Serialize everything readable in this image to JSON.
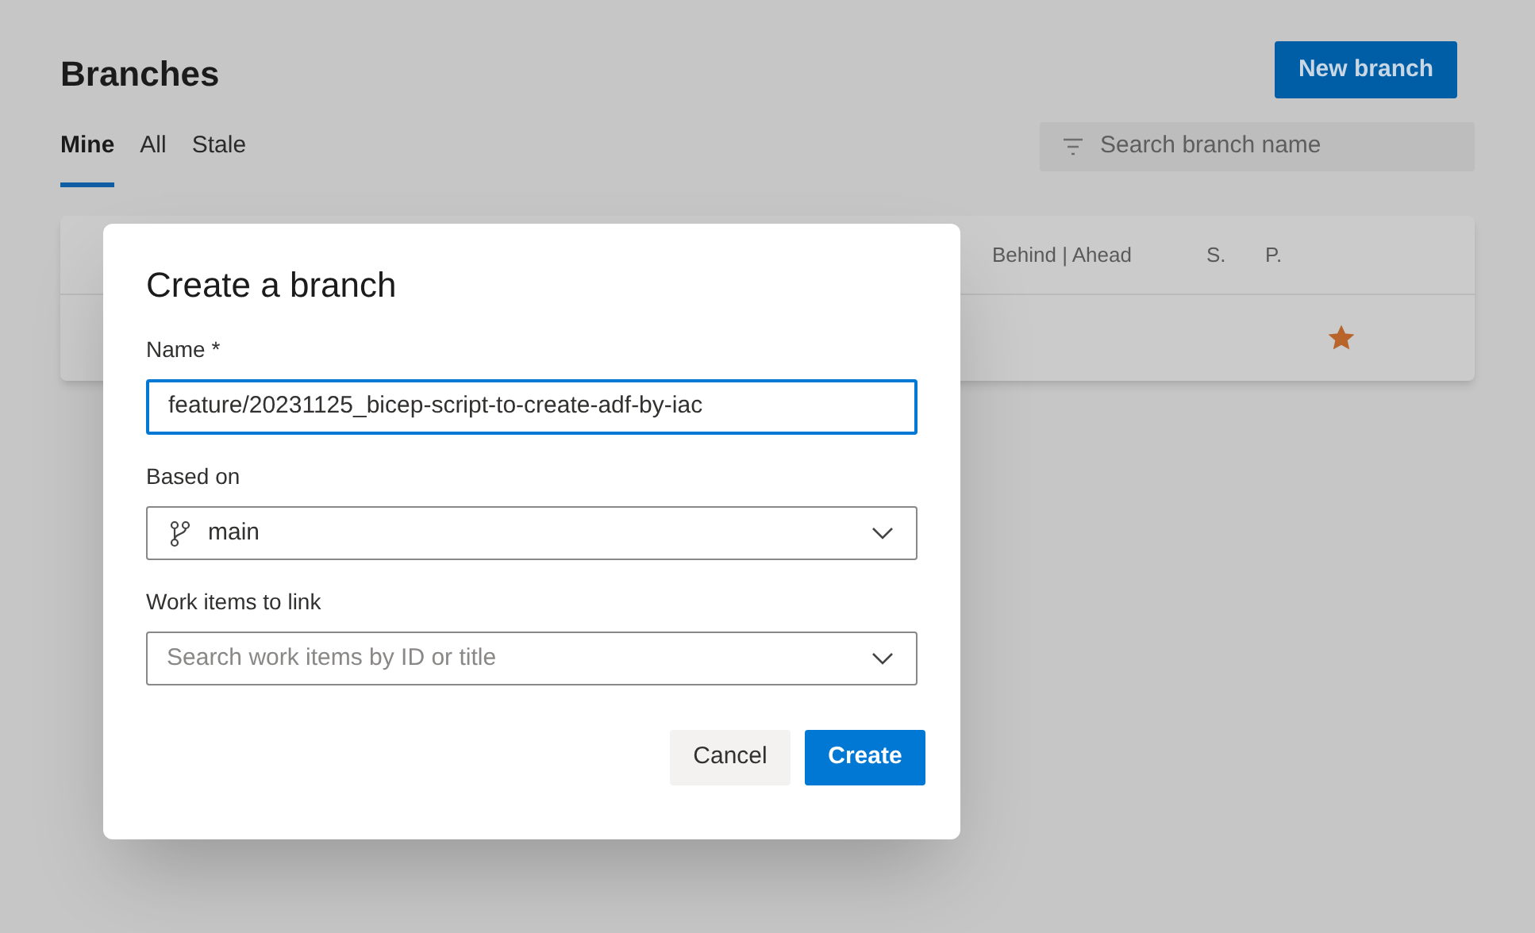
{
  "page": {
    "title": "Branches",
    "new_button": "New branch",
    "tabs": [
      {
        "label": "Mine",
        "selected": true
      },
      {
        "label": "All",
        "selected": false
      },
      {
        "label": "Stale",
        "selected": false
      }
    ],
    "search": {
      "placeholder": "Search branch name"
    },
    "table": {
      "columns": [
        "Behind | Ahead",
        "S.",
        "P."
      ],
      "rows": [
        {
          "favorite": true
        }
      ]
    }
  },
  "dialog": {
    "title": "Create a branch",
    "fields": [
      {
        "kind": "text",
        "label": "Name *",
        "value": "feature/20231125_bicep-script-to-create-adf-by-iac",
        "focused": true
      },
      {
        "kind": "branch",
        "label": "Based on",
        "value": "main"
      },
      {
        "kind": "select",
        "label": "Work items to link",
        "placeholder": "Search work items by ID or title"
      }
    ],
    "buttons": [
      {
        "label": "Cancel",
        "primary": false
      },
      {
        "label": "Create",
        "primary": true
      }
    ]
  }
}
